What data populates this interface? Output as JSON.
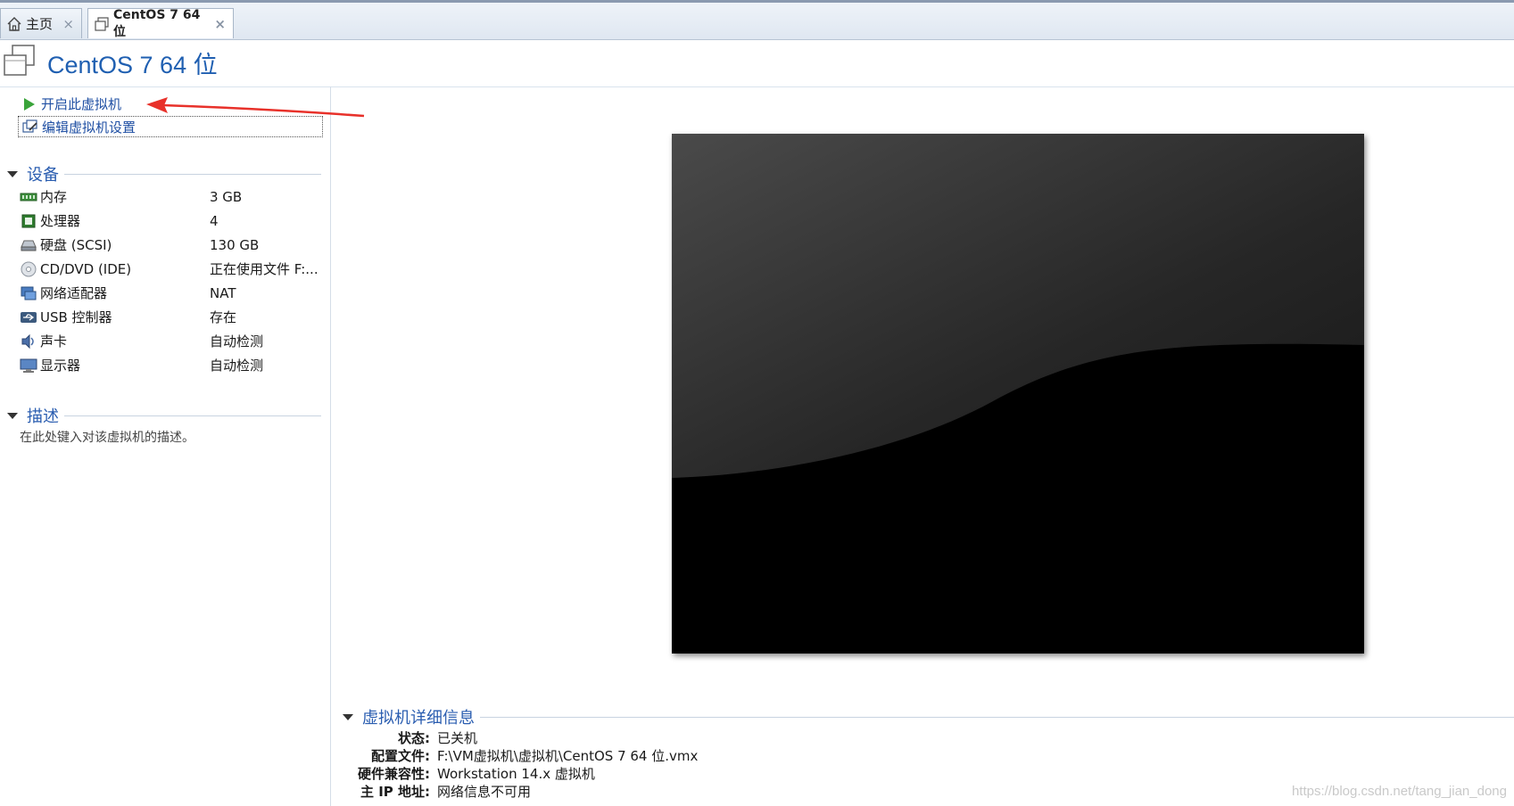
{
  "tabs": [
    {
      "label": "主页",
      "icon": "home-icon"
    },
    {
      "label": "CentOS 7 64 位",
      "icon": "vm-icon"
    }
  ],
  "close_glyph": "×",
  "page_title": "CentOS 7 64 位",
  "actions": {
    "power_on": "开启此虚拟机",
    "edit_settings": "编辑虚拟机设置"
  },
  "devices": {
    "title": "设备",
    "items": [
      {
        "name": "内存",
        "value": "3 GB",
        "icon": "memory-icon"
      },
      {
        "name": "处理器",
        "value": "4",
        "icon": "cpu-icon"
      },
      {
        "name": "硬盘 (SCSI)",
        "value": "130 GB",
        "icon": "harddisk-icon"
      },
      {
        "name": "CD/DVD (IDE)",
        "value": "正在使用文件 F:...",
        "icon": "cd-icon"
      },
      {
        "name": "网络适配器",
        "value": "NAT",
        "icon": "network-icon"
      },
      {
        "name": "USB 控制器",
        "value": "存在",
        "icon": "usb-icon"
      },
      {
        "name": "声卡",
        "value": "自动检测",
        "icon": "sound-icon"
      },
      {
        "name": "显示器",
        "value": "自动检测",
        "icon": "display-icon"
      }
    ]
  },
  "description": {
    "title": "描述",
    "placeholder": "在此处键入对该虚拟机的描述。"
  },
  "details": {
    "title": "虚拟机详细信息",
    "rows": [
      {
        "label": "状态:",
        "value": "已关机"
      },
      {
        "label": "配置文件:",
        "value": "F:\\VM虚拟机\\虚拟机\\CentOS 7 64 位.vmx"
      },
      {
        "label": "硬件兼容性:",
        "value": "Workstation 14.x 虚拟机"
      },
      {
        "label": "主 IP 地址:",
        "value": "网络信息不可用"
      }
    ]
  },
  "watermark": "https://blog.csdn.net/tang_jian_dong",
  "colors": {
    "accent": "#1f5fb1",
    "link": "#1f4fa3",
    "annotation_arrow": "#e8312a",
    "play_green": "#3aa43a"
  }
}
